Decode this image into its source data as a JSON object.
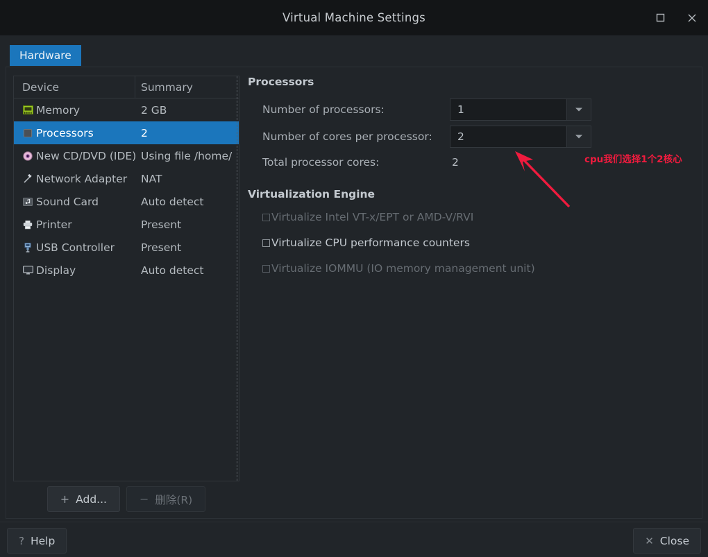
{
  "window": {
    "title": "Virtual Machine Settings",
    "maximize_icon": "maximize-icon",
    "close_icon": "close-icon"
  },
  "tabs": [
    {
      "label": "Hardware",
      "active": true
    }
  ],
  "device_list": {
    "columns": [
      "Device",
      "Summary"
    ],
    "rows": [
      {
        "icon": "memory-chip-icon",
        "name": "Memory",
        "summary": "2 GB",
        "selected": false
      },
      {
        "icon": "processor-chip-icon",
        "name": "Processors",
        "summary": "2",
        "selected": true
      },
      {
        "icon": "cd-dvd-disc-icon",
        "name": "New CD/DVD (IDE)",
        "summary": "Using file /home/",
        "selected": false
      },
      {
        "icon": "network-adapter-icon",
        "name": "Network Adapter",
        "summary": "NAT",
        "selected": false
      },
      {
        "icon": "sound-card-icon",
        "name": "Sound Card",
        "summary": "Auto detect",
        "selected": false
      },
      {
        "icon": "printer-icon",
        "name": "Printer",
        "summary": "Present",
        "selected": false
      },
      {
        "icon": "usb-controller-icon",
        "name": "USB Controller",
        "summary": "Present",
        "selected": false
      },
      {
        "icon": "display-monitor-icon",
        "name": "Display",
        "summary": "Auto detect",
        "selected": false
      }
    ],
    "add_button": {
      "label": "Add...",
      "symbol": "+",
      "enabled": true
    },
    "remove_button": {
      "label": "删除(R)",
      "symbol": "−",
      "enabled": false
    }
  },
  "processors_panel": {
    "section_title": "Processors",
    "fields": [
      {
        "label": "Number of processors:",
        "value": "1",
        "type": "dropdown"
      },
      {
        "label": "Number of cores per processor:",
        "value": "2",
        "type": "dropdown"
      },
      {
        "label": "Total processor cores:",
        "value": "2",
        "type": "static"
      }
    ]
  },
  "virtualization_panel": {
    "section_title": "Virtualization Engine",
    "checkboxes": [
      {
        "label": "Virtualize Intel VT-x/EPT or AMD-V/RVI",
        "checked": false,
        "enabled": false
      },
      {
        "label": "Virtualize CPU performance counters",
        "checked": false,
        "enabled": true
      },
      {
        "label": "Virtualize IOMMU (IO memory management unit)",
        "checked": false,
        "enabled": false
      }
    ]
  },
  "annotation": {
    "text": "cpu我们选择1个2核心",
    "color": "#f01b3e",
    "arrow": "red-arrow-annotation"
  },
  "footer": {
    "help_button": {
      "label": "Help",
      "symbol": "?"
    },
    "close_button": {
      "label": "Close",
      "symbol": "✕"
    }
  },
  "colors": {
    "accent": "#1b76bc",
    "window_bg": "#212529",
    "titlebar_bg": "#131517",
    "annotation_red": "#f01b3e"
  }
}
